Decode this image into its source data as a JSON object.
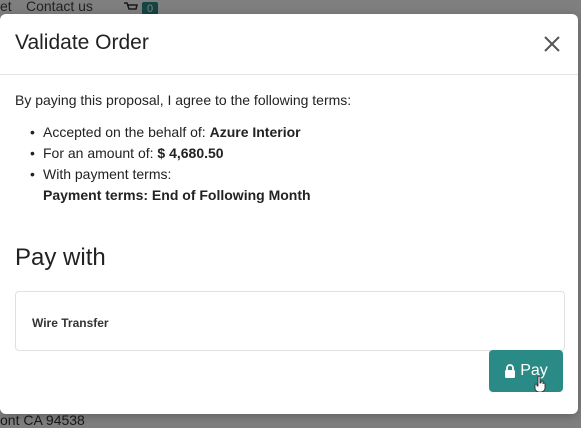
{
  "background": {
    "nav": [
      "et",
      "Contact us"
    ],
    "cart_count": "0",
    "address_fragment": "ont CA 94538"
  },
  "modal": {
    "title": "Validate Order",
    "intro": "By paying this proposal, I agree to the following terms:",
    "terms": {
      "accepted_prefix": "Accepted on the behalf of: ",
      "accepted_value": "Azure Interior",
      "amount_prefix": "For an amount of: ",
      "amount_value": "$ 4,680.50",
      "payment_prefix": "With payment terms:",
      "payment_value": "Payment terms: End of Following Month"
    },
    "pay_with": "Pay with",
    "payment_method": "Wire Transfer",
    "pay_button": "Pay"
  },
  "colors": {
    "accent": "#2a8a86"
  },
  "icons": [
    "close-icon",
    "lock-icon",
    "cart-icon",
    "hand-cursor-icon"
  ]
}
